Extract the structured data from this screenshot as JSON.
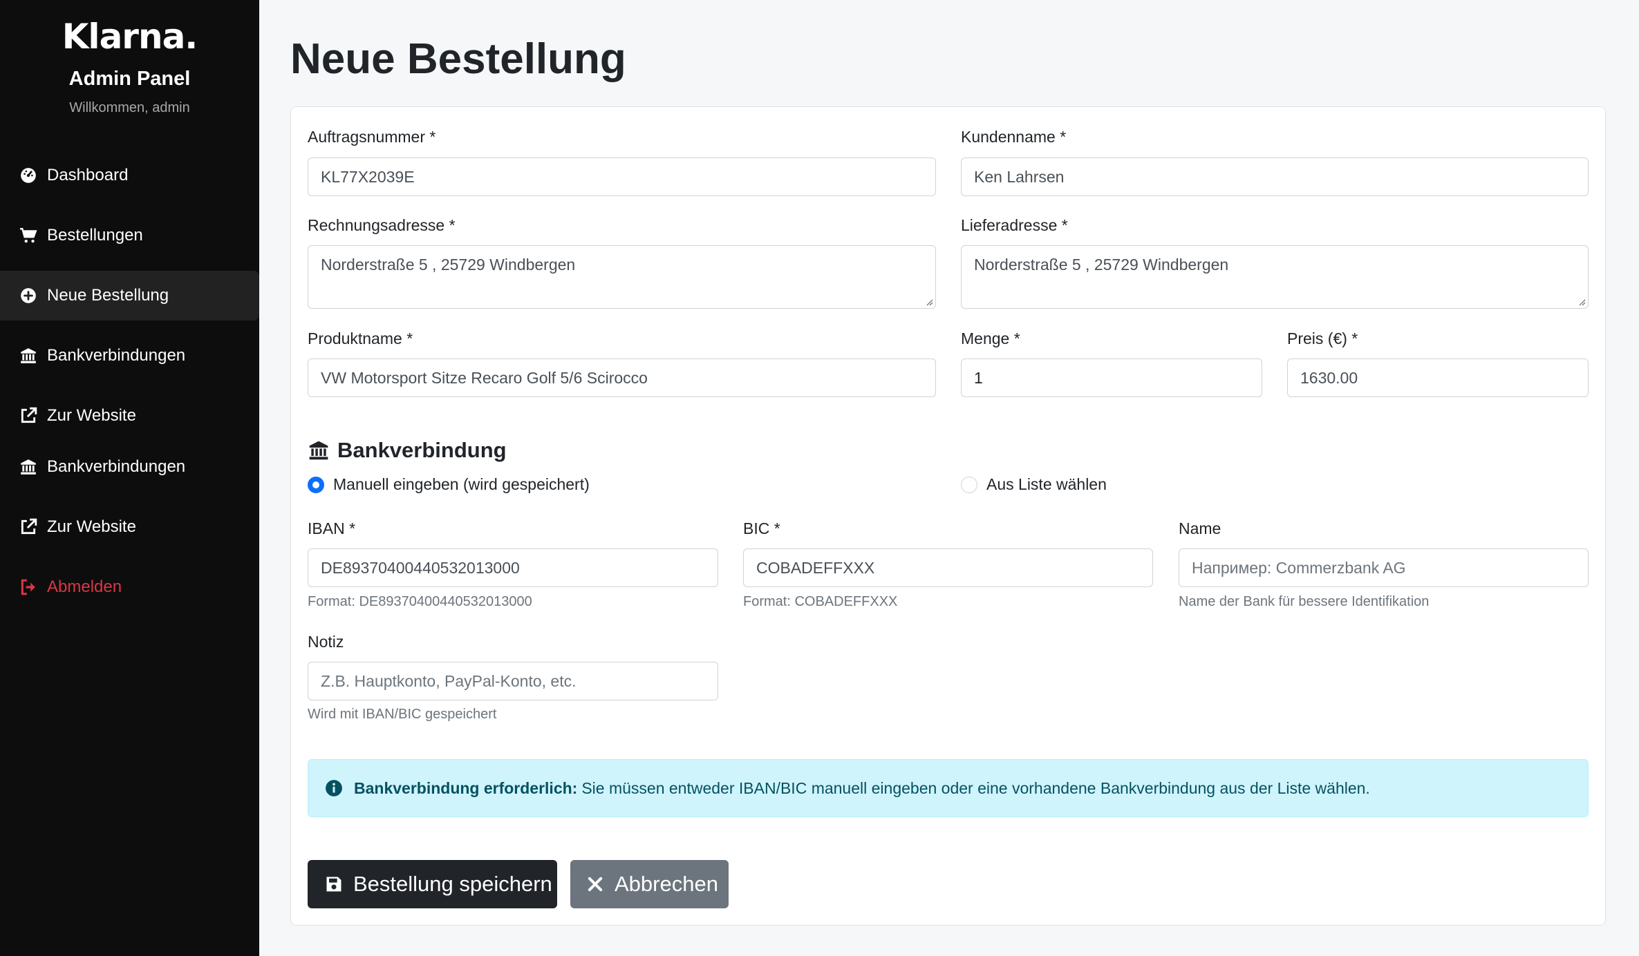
{
  "sidebar": {
    "logo": "Klarna.",
    "title": "Admin Panel",
    "welcome": "Willkommen, admin",
    "items": [
      {
        "label": "Dashboard",
        "icon": "dashboard-icon"
      },
      {
        "label": "Bestellungen",
        "icon": "cart-icon"
      },
      {
        "label": "Neue Bestellung",
        "icon": "plus-circle-icon",
        "active": true
      },
      {
        "label": "Bankverbindungen",
        "icon": "bank-icon"
      },
      {
        "label": "Zur Website",
        "icon": "external-link-icon"
      },
      {
        "label": "Bankverbindungen",
        "icon": "bank-icon"
      },
      {
        "label": "Zur Website",
        "icon": "external-link-icon"
      },
      {
        "label": "Abmelden",
        "icon": "logout-icon"
      }
    ]
  },
  "page": {
    "title": "Neue Bestellung"
  },
  "form": {
    "order_number": {
      "label": "Auftragsnummer *",
      "value": "KL77X2039E"
    },
    "customer_name": {
      "label": "Kundenname *",
      "value": "Ken Lahrsen"
    },
    "billing_address": {
      "label": "Rechnungsadresse *",
      "value": "Norderstraße 5 , 25729 Windbergen"
    },
    "shipping_address": {
      "label": "Lieferadresse *",
      "value": "Norderstraße 5 , 25729 Windbergen"
    },
    "product_name": {
      "label": "Produktname *",
      "value": "VW Motorsport Sitze Recaro Golf 5/6 Scirocco"
    },
    "quantity": {
      "label": "Menge *",
      "value": "1"
    },
    "price": {
      "label": "Preis (€) *",
      "value": "1630.00"
    }
  },
  "bank": {
    "section_title": "Bankverbindung",
    "radio_manual": "Manuell eingeben (wird gespeichert)",
    "radio_list": "Aus Liste wählen",
    "selected": "manual",
    "iban": {
      "label": "IBAN *",
      "value": "DE89370400440532013000",
      "help": "Format: DE89370400440532013000"
    },
    "bic": {
      "label": "BIC *",
      "value": "COBADEFFXXX",
      "help": "Format: COBADEFFXXX"
    },
    "name": {
      "label": "Name",
      "placeholder": "Например: Commerzbank AG",
      "help": "Name der Bank für bessere Identifikation"
    },
    "note": {
      "label": "Notiz",
      "placeholder": "Z.B. Hauptkonto, PayPal-Konto, etc.",
      "help": "Wird mit IBAN/BIC gespeichert"
    }
  },
  "alert": {
    "strong": "Bankverbindung erforderlich:",
    "text": "Sie müssen entweder IBAN/BIC manuell eingeben oder eine vorhandene Bankverbindung aus der Liste wählen."
  },
  "buttons": {
    "save": "Bestellung speichern",
    "cancel": "Abbrechen"
  },
  "colors": {
    "sidebar_bg": "#0d0d0d",
    "logout": "#dc3545",
    "radio_checked": "#0d6efd",
    "alert_bg": "#cff4fc",
    "primary_button": "#212529",
    "secondary_button": "#6c757d"
  }
}
